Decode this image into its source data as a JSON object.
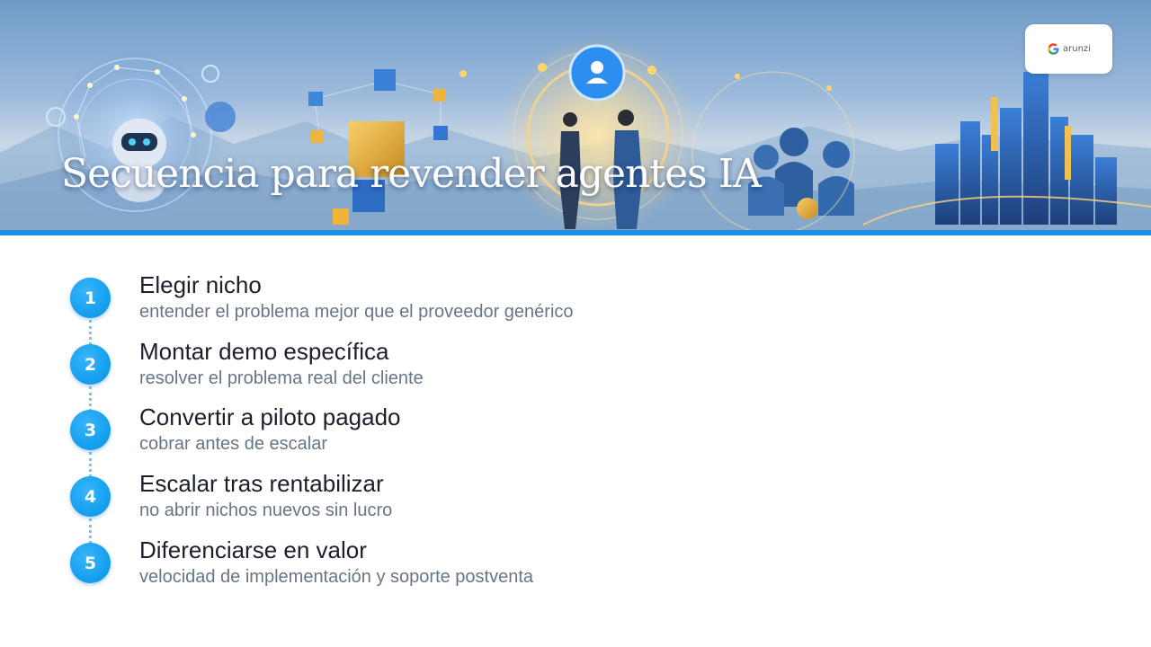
{
  "slide": {
    "title": "Secuencia para revender agentes IA"
  },
  "logo": {
    "text": "arunzi",
    "icon": "google-g-icon"
  },
  "steps": [
    {
      "number": "1",
      "title": "Elegir nicho",
      "description": "entender el problema mejor que el proveedor genérico"
    },
    {
      "number": "2",
      "title": "Montar demo específica",
      "description": "resolver el problema real del cliente"
    },
    {
      "number": "3",
      "title": "Convertir a piloto pagado",
      "description": "cobrar antes de escalar"
    },
    {
      "number": "4",
      "title": "Escalar tras rentabilizar",
      "description": "no abrir nichos nuevos sin lucro"
    },
    {
      "number": "5",
      "title": "Diferenciarse en valor",
      "description": "velocidad de implementación y soporte postventa"
    }
  ],
  "colors": {
    "accent": "#139ded",
    "rule": "#1f8fe6",
    "title_text": "#1a1f2b",
    "desc_text": "#687586"
  }
}
